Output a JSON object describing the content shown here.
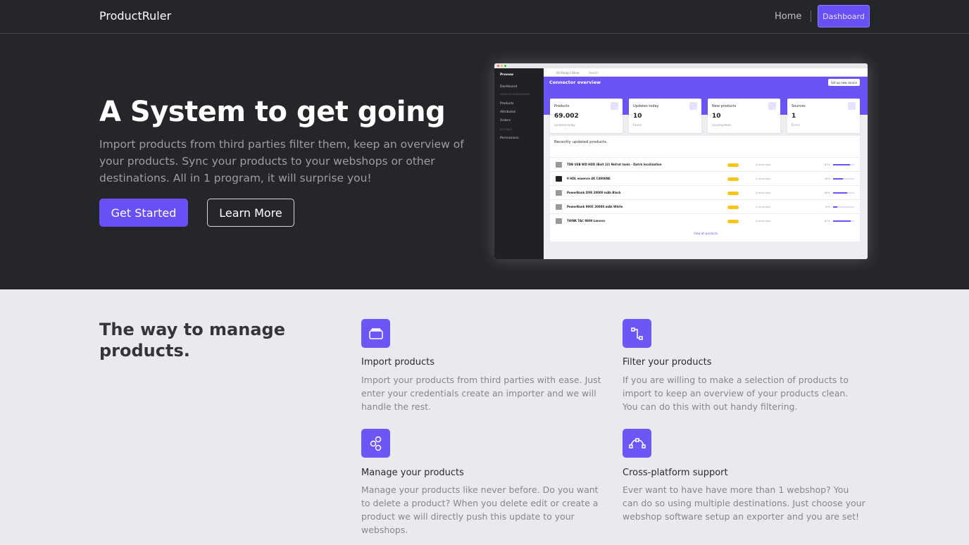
{
  "nav": {
    "brand": "ProductRuler",
    "home": "Home",
    "dashboard": "Dashboard"
  },
  "hero": {
    "title": "A System to get going",
    "text": "Import products from third parties filter them, keep an overview of your products. Sync your products to your webshops or other destinations. All in 1 program, it will surprise you!",
    "primary_cta": "Get Started",
    "secondary_cta": "Learn More"
  },
  "mock": {
    "app_name": "Pronow",
    "breadcrumb": "Ali Rastg's Store",
    "search": "Search",
    "sidebar": {
      "dashboard": "Dashboard",
      "section": "CATALOG MANAGEMENT",
      "products": "Products",
      "attributes": "Attributes",
      "orders": "Orders",
      "section2": "SETTINGS",
      "permissions": "Permissions"
    },
    "band_title": "Connector overview",
    "band_button": "Set up new source",
    "stats": [
      {
        "label": "Products",
        "value": "69.002",
        "sub": "Updated today"
      },
      {
        "label": "Updates today",
        "value": "10",
        "sub": "Failed"
      },
      {
        "label": "New products",
        "value": "10",
        "sub": "Uncompleted"
      },
      {
        "label": "Sources",
        "value": "1",
        "sub": "Errors"
      }
    ],
    "table_title": "Recently updated products",
    "rows": [
      {
        "name": "TDB USB WD HDD (Bolt 12) Nofrat tools - Dutch localization",
        "age": "2 hours ago",
        "pct": "81%",
        "progress": 0.81
      },
      {
        "name": "9 HDL essence 4K C4908NE",
        "age": "2 hours ago",
        "pct": "48%",
        "progress": 0.48
      },
      {
        "name": "PowerBank DXR 20000 mAh Black",
        "age": "2 hours ago",
        "pct": "66%",
        "progress": 0.66
      },
      {
        "name": "PowerBank 9005 20000 mAh White",
        "age": "2 hours ago",
        "pct": "70%",
        "progress": 0.2
      },
      {
        "name": "THINK TAC 9800 Lenovo",
        "age": "2 hours ago",
        "pct": "82%",
        "progress": 0.82
      }
    ],
    "view_all": "View all products"
  },
  "features": {
    "title": "The way to manage products.",
    "items": [
      {
        "icon": "folder-icon",
        "name": "Import products",
        "desc": "Import your products from third parties with ease. Just enter your credentials create an importer and we will handle the rest."
      },
      {
        "icon": "filter-icon",
        "name": "Filter your products",
        "desc": "If you are willing to make a selection of products to import to keep an overview of your products clean. You can do this with out handy filtering."
      },
      {
        "icon": "manage-icon",
        "name": "Manage your products",
        "desc": "Manage your products like never before. Do you want to delete a product? When you delete edit or create a product we will directly push this update to your webshops."
      },
      {
        "icon": "bezier-icon",
        "name": "Cross-platform support",
        "desc": "Ever want to have have more than 1 webshop? You can do so using multiple destinations. Just choose your webshop software setup an exporter and you are set!"
      }
    ]
  },
  "colors": {
    "accent": "#6750f5",
    "dark": "#25262a",
    "light": "#e9eaee"
  }
}
